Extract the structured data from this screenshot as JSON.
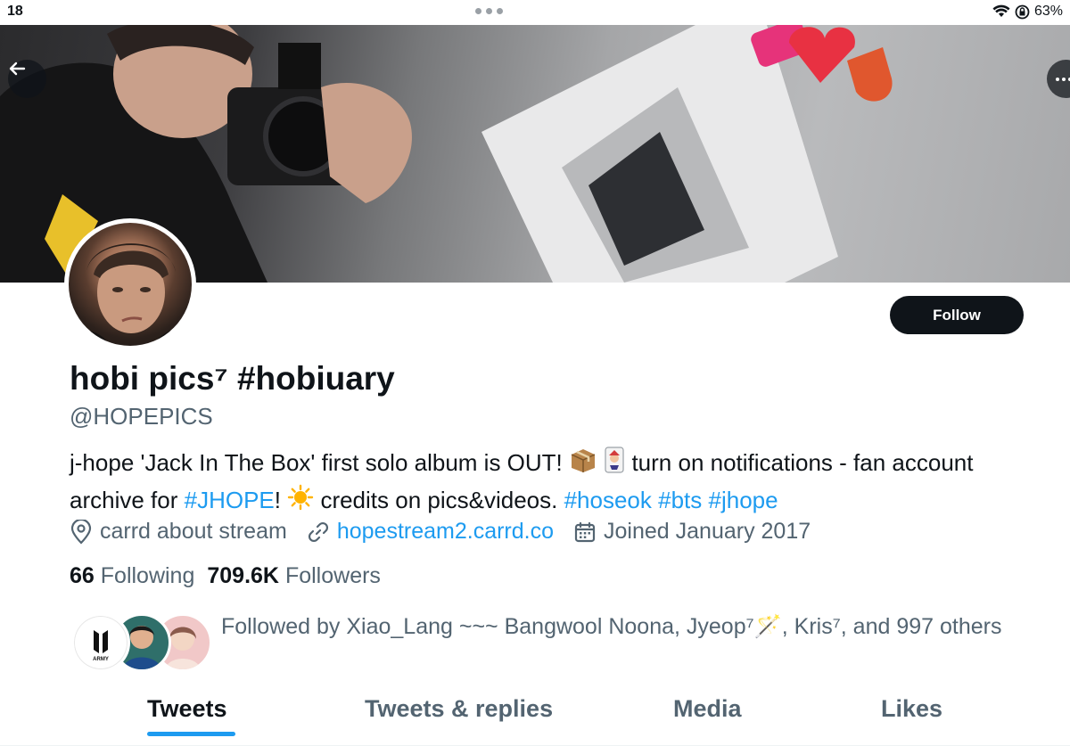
{
  "status_bar": {
    "time": "18",
    "battery": "63%"
  },
  "profile": {
    "display_name": "hobi pics⁷ #hobiuary",
    "handle": "@HOPEPICS",
    "follow_label": "Follow",
    "bio": {
      "part1": "j-hope 'Jack In The Box' first solo album is OUT! ",
      "part2": " turn on notifications - fan account archive for ",
      "link_jhope": "#JHOPE",
      "part3": "! ",
      "part4": " credits on pics&videos. ",
      "tag_hoseok": "#hoseok",
      "tag_bts": "#bts",
      "tag_jhope": "#jhope"
    },
    "location": "carrd about stream",
    "website": "hopestream2.carrd.co",
    "joined": "Joined January 2017",
    "following_count": "66",
    "following_label": "Following",
    "followers_count": "709.6K",
    "followers_label": "Followers",
    "followed_by": "Followed by Xiao_Lang ~~~ Bangwool Noona, Jyeop⁷🪄, Kris⁷, and 997 others"
  },
  "tabs": [
    {
      "label": "Tweets",
      "active": true
    },
    {
      "label": "Tweets & replies",
      "active": false
    },
    {
      "label": "Media",
      "active": false
    },
    {
      "label": "Likes",
      "active": false
    }
  ],
  "icons": {
    "back": "arrow-left-icon",
    "more": "more-icon",
    "location": "location-pin-icon",
    "website": "link-icon",
    "joined": "calendar-icon"
  },
  "colors": {
    "accent": "#1d9bf0",
    "text": "#0f1419",
    "secondary": "#536471",
    "button": "#0f1419"
  }
}
